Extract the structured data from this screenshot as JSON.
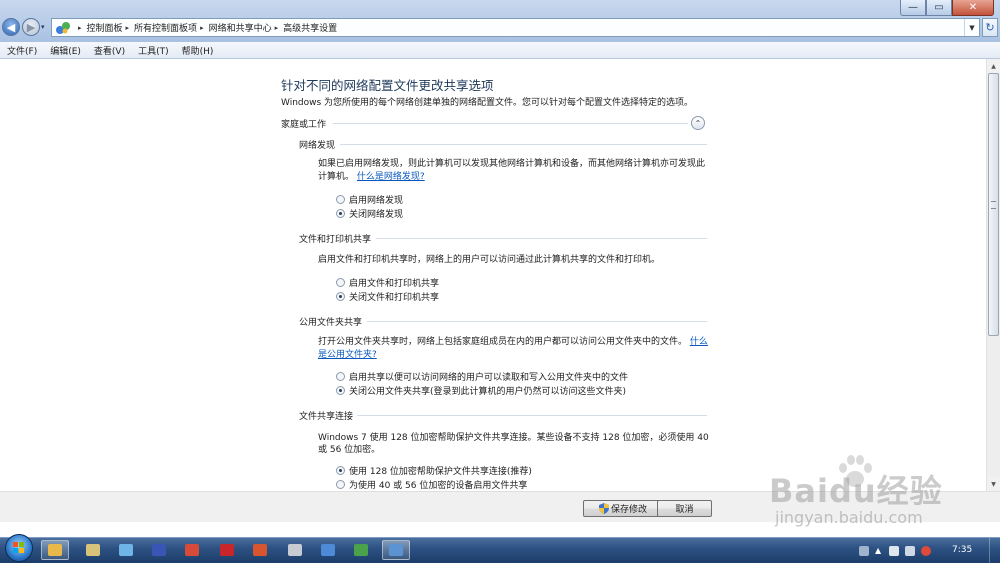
{
  "window": {
    "controls": [
      "—",
      "▭",
      "✕"
    ],
    "breadcrumbs": [
      "控制面板",
      "所有控制面板项",
      "网络和共享中心",
      "高级共享设置"
    ],
    "separator": "▸",
    "history_arrow": "▾",
    "address_dropdown": "▼"
  },
  "menu": [
    "文件(F)",
    "编辑(E)",
    "查看(V)",
    "工具(T)",
    "帮助(H)"
  ],
  "page": {
    "title": "针对不同的网络配置文件更改共享选项",
    "description": "Windows 为您所使用的每个网络创建单独的网络配置文件。您可以针对每个配置文件选择特定的选项。",
    "profile_heading": "家庭或工作",
    "collapse_symbol": "⌃",
    "network_discovery": {
      "heading": "网络发现",
      "text_line1": "如果已启用网络发现，则此计算机可以发现其他网络计算机和设备，而其他网络计算机亦可发现此",
      "text_line2": "计算机。",
      "link": "什么是网络发现?",
      "options": [
        {
          "label": "启用网络发现",
          "checked": false
        },
        {
          "label": "关闭网络发现",
          "checked": true
        }
      ]
    },
    "file_printer_sharing": {
      "heading": "文件和打印机共享",
      "text": "启用文件和打印机共享时，网络上的用户可以访问通过此计算机共享的文件和打印机。",
      "options": [
        {
          "label": "启用文件和打印机共享",
          "checked": false
        },
        {
          "label": "关闭文件和打印机共享",
          "checked": true
        }
      ]
    },
    "public_folder_sharing": {
      "heading": "公用文件夹共享",
      "text_line1": "打开公用文件夹共享时，网络上包括家庭组成员在内的用户都可以访问公用文件夹中的文件。",
      "link_part1": "什么",
      "link_part2": "是公用文件夹?",
      "options": [
        {
          "label": "启用共享以便可以访问网络的用户可以读取和写入公用文件夹中的文件",
          "checked": false
        },
        {
          "label": "关闭公用文件夹共享(登录到此计算机的用户仍然可以访问这些文件夹)",
          "checked": true
        }
      ]
    },
    "file_sharing_connections": {
      "heading": "文件共享连接",
      "text_line1": "Windows 7 使用 128 位加密帮助保护文件共享连接。某些设备不支持 128 位加密，必须使用 40",
      "text_line2": "或 56 位加密。",
      "options": [
        {
          "label": "使用 128 位加密帮助保护文件共享连接(推荐)",
          "checked": true
        },
        {
          "label": "为使用 40 或 56 位加密的设备启用文件共享",
          "checked": false
        }
      ]
    }
  },
  "buttons": {
    "save": "保存修改",
    "cancel": "取消"
  },
  "taskbar": {
    "clock": "7:35"
  },
  "watermark": {
    "brand": "Baidu经验",
    "url": "jingyan.baidu.com"
  },
  "colors": {
    "title_text": "#1e395b",
    "link": "#0a58bf",
    "taskbar": "#2d5283"
  }
}
